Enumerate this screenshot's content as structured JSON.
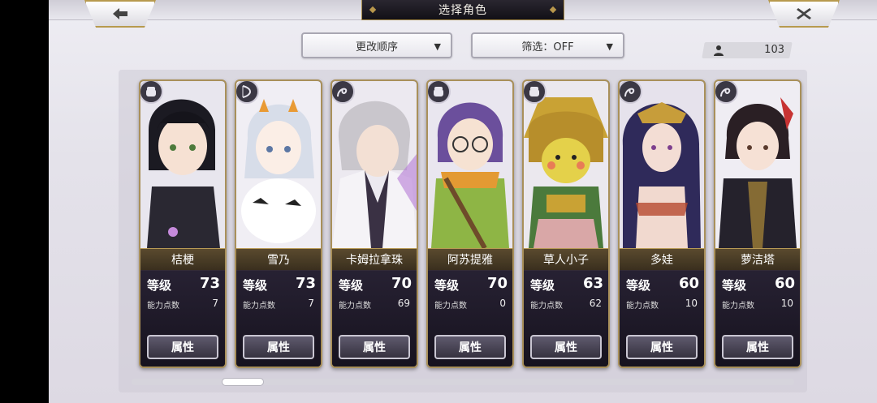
{
  "header": {
    "title": "选择角色",
    "back_icon": "arrow-left-icon",
    "close_icon": "close-x-icon"
  },
  "toolbar": {
    "order_label": "更改顺序",
    "filter_label": "筛选：OFF",
    "user_count": "103",
    "user_icon": "person-icon"
  },
  "labels": {
    "level": "等级",
    "ability_points": "能力点数",
    "attr_button": "属性"
  },
  "characters": [
    {
      "name": "桔梗",
      "level": "73",
      "ability_points": "7",
      "type_icon": "fist-icon"
    },
    {
      "name": "雪乃",
      "level": "73",
      "ability_points": "7",
      "type_icon": "bow-icon"
    },
    {
      "name": "卡姆拉拿珠",
      "level": "70",
      "ability_points": "69",
      "type_icon": "whip-icon"
    },
    {
      "name": "阿苏提雅",
      "level": "70",
      "ability_points": "0",
      "type_icon": "fist-icon"
    },
    {
      "name": "草人小子",
      "level": "63",
      "ability_points": "62",
      "type_icon": "fist-icon"
    },
    {
      "name": "多娃",
      "level": "60",
      "ability_points": "10",
      "type_icon": "whip-icon"
    },
    {
      "name": "萝洁塔",
      "level": "60",
      "ability_points": "10",
      "type_icon": "whip-icon"
    }
  ],
  "colors": {
    "gold_trim": "#b89a55",
    "card_bg": "#1d1a26",
    "panel_bg": "#e4e2ea"
  },
  "scroll": {
    "position": 0.15
  }
}
